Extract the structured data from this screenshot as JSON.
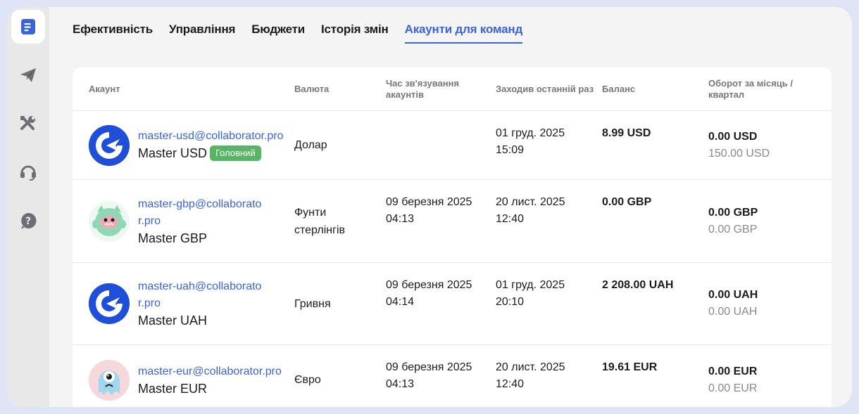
{
  "tabs": [
    {
      "label": "Ефективність",
      "active": false
    },
    {
      "label": "Управління",
      "active": false
    },
    {
      "label": "Бюджети",
      "active": false
    },
    {
      "label": "Історія змін",
      "active": false
    },
    {
      "label": "Акаунти для команд",
      "active": true
    }
  ],
  "sidebar": {
    "icons": [
      "document-icon",
      "send-icon",
      "tools-icon",
      "headset-icon",
      "help-icon"
    ]
  },
  "table": {
    "headers": {
      "account": "Акаунт",
      "currency": "Валюта",
      "link_time": "Час зв'язування акаунтів",
      "last_login": "Заходив останній раз",
      "balance": "Баланс",
      "turnover": "Оборот за місяць / квартал"
    },
    "rows": [
      {
        "email": "master-usd@collaborator.pro",
        "name": "Master USD",
        "badge": "Головний",
        "currency": "Долар",
        "link_date": "",
        "link_time": "",
        "last_date": "01 груд. 2025",
        "last_time": "15:09",
        "balance": "8.99 USD",
        "turnover_month": "0.00 USD",
        "turnover_quarter": "150.00 USD",
        "avatar": "collaborator-logo"
      },
      {
        "email": "master-gbp@collaborator.pro",
        "name": "Master GBP",
        "badge": "",
        "currency": "Фунти стерлінгів",
        "link_date": "09 березня 2025",
        "link_time": "04:13",
        "last_date": "20 лист. 2025",
        "last_time": "12:40",
        "balance": "0.00 GBP",
        "turnover_month": "0.00 GBP",
        "turnover_quarter": "0.00 GBP",
        "avatar": "green-monster"
      },
      {
        "email": "master-uah@collaborator.pro",
        "name": "Master UAH",
        "badge": "",
        "currency": "Гривня",
        "link_date": "09 березня 2025",
        "link_time": "04:14",
        "last_date": "01 груд. 2025",
        "last_time": "20:10",
        "balance": "2 208.00 UAH",
        "turnover_month": "0.00 UAH",
        "turnover_quarter": "0.00 UAH",
        "avatar": "collaborator-logo"
      },
      {
        "email": "master-eur@collaborator.pro",
        "name": "Master EUR",
        "badge": "",
        "currency": "Євро",
        "link_date": "09 березня 2025",
        "link_time": "04:13",
        "last_date": "20 лист. 2025",
        "last_time": "12:40",
        "balance": "19.61 EUR",
        "turnover_month": "0.00 EUR",
        "turnover_quarter": "0.00 EUR",
        "avatar": "blue-monster"
      }
    ]
  },
  "colors": {
    "accent": "#3b63d8",
    "badge": "#59b565",
    "logo": "#1f4fd8"
  }
}
